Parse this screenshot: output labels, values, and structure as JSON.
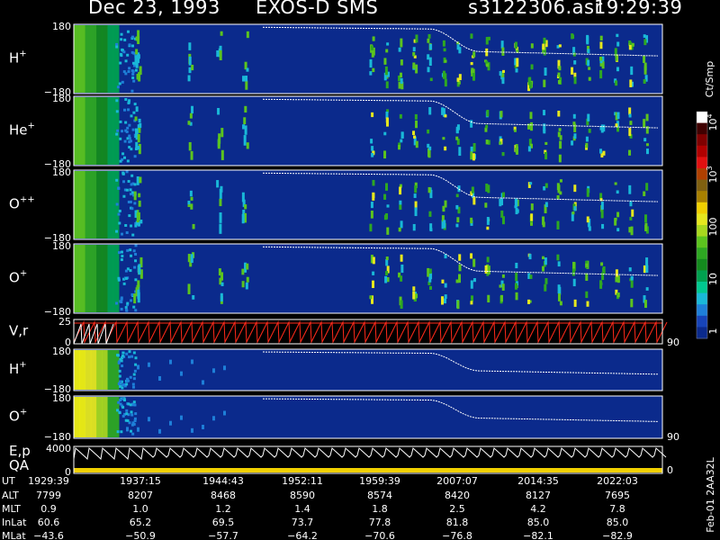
{
  "header": {
    "date": "Dec 23, 1993",
    "instrument": "EXOS-D SMS",
    "file": "s3122306.asr",
    "time": "19:29:39"
  },
  "colors": {
    "background": "#000000",
    "panel": "#0b2a8c",
    "trace": "#ffffff",
    "velocity": "#ff2a1a"
  },
  "chart_data": {
    "type": "heatmap",
    "x_kind": "time (UT)",
    "x_range": [
      "19:29:39",
      "20:26:00"
    ],
    "panels": [
      {
        "label": "H",
        "sup": "+",
        "y_top": "180",
        "y_bottom": "−180",
        "ylim": [
          -180,
          180
        ]
      },
      {
        "label": "He",
        "sup": "+",
        "y_top": "180",
        "y_bottom": "−180",
        "ylim": [
          -180,
          180
        ]
      },
      {
        "label": "O",
        "sup": "++",
        "y_top": "180",
        "y_bottom": "−180",
        "ylim": [
          -180,
          180
        ]
      },
      {
        "label": "O",
        "sup": "+",
        "y_top": "180",
        "y_bottom": "−180",
        "ylim": [
          -180,
          180
        ]
      },
      {
        "label": "V,r",
        "sup": "",
        "y_top": "25",
        "y_bottom": "0",
        "ylim": [
          0,
          25
        ],
        "right_label": "90"
      },
      {
        "label": "H",
        "sup": "+",
        "y_top": "180",
        "y_bottom": "−180",
        "ylim": [
          -180,
          180
        ]
      },
      {
        "label": "O",
        "sup": "+",
        "y_top": "180",
        "y_bottom": "−180",
        "ylim": [
          -180,
          180
        ],
        "right_label": "90"
      },
      {
        "label": "E,p",
        "sub": "QA",
        "y_top": "4000",
        "y_bottom": "0",
        "ylim": [
          0,
          4000
        ],
        "right_label": "0"
      }
    ],
    "colorbar": {
      "unit": "Ct/Smp",
      "ticks": [
        {
          "text": "1",
          "value": 1
        },
        {
          "text": "10",
          "value": 10
        },
        {
          "text": "100",
          "value": 100
        },
        {
          "text": "10",
          "sup": "3",
          "value": 1000
        },
        {
          "text": "10",
          "sup": "4",
          "value": 10000
        }
      ],
      "side_labels": [
        "90",
        "0"
      ],
      "colors": [
        "#0b2a8c",
        "#1744b8",
        "#1e7fd8",
        "#19b8d8",
        "#00c890",
        "#00a050",
        "#148a1e",
        "#2ea822",
        "#5cc41e",
        "#a8d81e",
        "#e6e81e",
        "#f0d000",
        "#a88000",
        "#806010",
        "#b04000",
        "#e01010",
        "#b00000",
        "#800000",
        "#400000",
        "#ffffff"
      ]
    },
    "footer": {
      "row_labels": [
        "UT",
        "ALT",
        "MLT",
        "InLat",
        "MLat"
      ],
      "columns": [
        {
          "UT": "1929:39",
          "ALT": "7799",
          "MLT": "0.9",
          "InLat": "60.6",
          "MLat": "−43.6"
        },
        {
          "UT": "1937:15",
          "ALT": "8207",
          "MLT": "1.0",
          "InLat": "65.2",
          "MLat": "−50.9"
        },
        {
          "UT": "1944:43",
          "ALT": "8468",
          "MLT": "1.2",
          "InLat": "69.5",
          "MLat": "−57.7"
        },
        {
          "UT": "1952:11",
          "ALT": "8590",
          "MLT": "1.4",
          "InLat": "73.7",
          "MLat": "−64.2"
        },
        {
          "UT": "1959:39",
          "ALT": "8574",
          "MLT": "1.8",
          "InLat": "77.8",
          "MLat": "−70.6"
        },
        {
          "UT": "2007:07",
          "ALT": "8420",
          "MLT": "2.5",
          "InLat": "81.8",
          "MLat": "−76.8"
        },
        {
          "UT": "2014:35",
          "ALT": "8127",
          "MLT": "4.2",
          "InLat": "85.0",
          "MLat": "−82.1"
        },
        {
          "UT": "2022:03",
          "ALT": "7695",
          "MLT": "7.8",
          "InLat": "85.0",
          "MLat": "−82.9"
        }
      ]
    },
    "side_stamp": "Feb-01 2AA32L"
  }
}
